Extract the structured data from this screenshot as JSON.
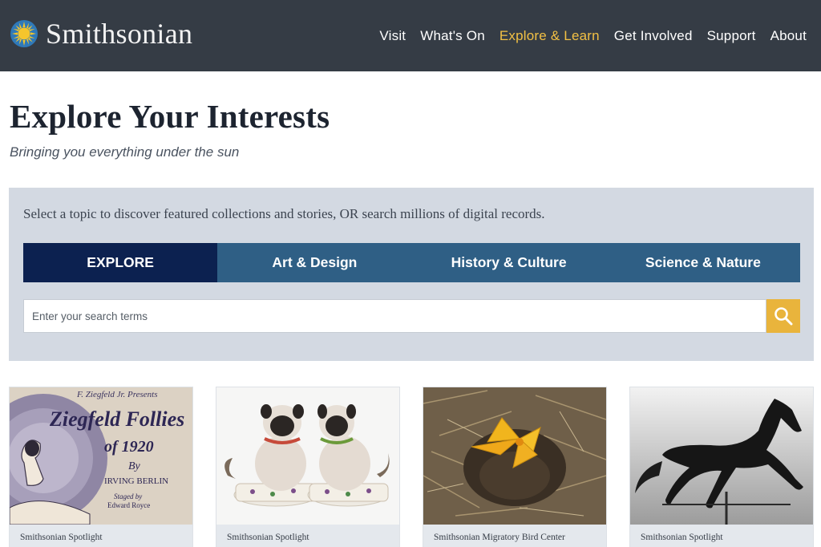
{
  "header": {
    "logo_text": "Smithsonian",
    "logo_icon": "sun-icon",
    "nav": [
      {
        "label": "Visit"
      },
      {
        "label": "What's On"
      },
      {
        "label": "Explore & Learn",
        "active": true
      },
      {
        "label": "Get Involved"
      },
      {
        "label": "Support"
      },
      {
        "label": "About"
      }
    ]
  },
  "intro": {
    "title": "Explore Your Interests",
    "subtitle": "Bringing you everything under the sun"
  },
  "search_panel": {
    "instructions": "Select a topic to discover featured collections and stories, OR search millions of digital records.",
    "tabs": [
      {
        "label": "EXPLORE",
        "active": true
      },
      {
        "label": "Art & Design"
      },
      {
        "label": "History & Culture"
      },
      {
        "label": "Science & Nature"
      }
    ],
    "search": {
      "placeholder": "Enter your search terms",
      "value": "",
      "button_icon": "search-icon"
    }
  },
  "cards": [
    {
      "source": "Smithsonian Spotlight",
      "image": "ziegfeld-follies-sheet-music"
    },
    {
      "source": "Smithsonian Spotlight",
      "image": "porcelain-pug-figurines"
    },
    {
      "source": "Smithsonian Migratory Bird Center",
      "image": "baby-birds-in-nest"
    },
    {
      "source": "Smithsonian Spotlight",
      "image": "black-horse-weathervane"
    }
  ],
  "card_image_text": {
    "presenter": "F. Ziegfeld Jr. Presents",
    "title_line1": "Ziegfeld Follies",
    "title_line2": "of 1920",
    "by": "By",
    "composer": "IRVING BERLIN",
    "staged_by": "Staged by",
    "director": "Edward Royce"
  },
  "colors": {
    "header_bg": "#353c45",
    "nav_active": "#f2c044",
    "panel_bg": "#d3d9e2",
    "tab_active": "#0c2150",
    "tab_bg": "#2f5f85",
    "search_button": "#e9b43c"
  }
}
